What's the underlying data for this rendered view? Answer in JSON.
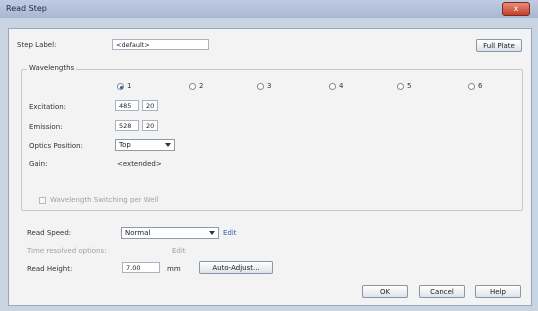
{
  "window": {
    "title": "Read Step",
    "close_symbol": "x"
  },
  "step": {
    "label": "Step Label:",
    "value": "<default>",
    "full_plate_button": "Full Plate"
  },
  "wavelengths": {
    "group_title": "Wavelengths",
    "options": [
      "1",
      "2",
      "3",
      "4",
      "5",
      "6"
    ],
    "selected": "1",
    "excitation": {
      "label": "Excitation:",
      "value": "485",
      "bandwidth": "20"
    },
    "emission": {
      "label": "Emission:",
      "value": "528",
      "bandwidth": "20"
    },
    "optics_position": {
      "label": "Optics Position:",
      "value": "Top"
    },
    "gain": {
      "label": "Gain:",
      "value": "<extended>"
    },
    "switching_checkbox": "Wavelength Switching per Well"
  },
  "read_speed": {
    "label": "Read Speed:",
    "value": "Normal",
    "edit_link": "Edit"
  },
  "time_resolved": {
    "label": "Time resolved options:",
    "edit_link": "Edit"
  },
  "read_height": {
    "label": "Read Height:",
    "value": "7.00",
    "unit": "mm",
    "auto_adjust_button": "Auto-Adjust..."
  },
  "footer": {
    "ok_button": "OK",
    "cancel_button": "Cancel",
    "help_button": "Help"
  }
}
